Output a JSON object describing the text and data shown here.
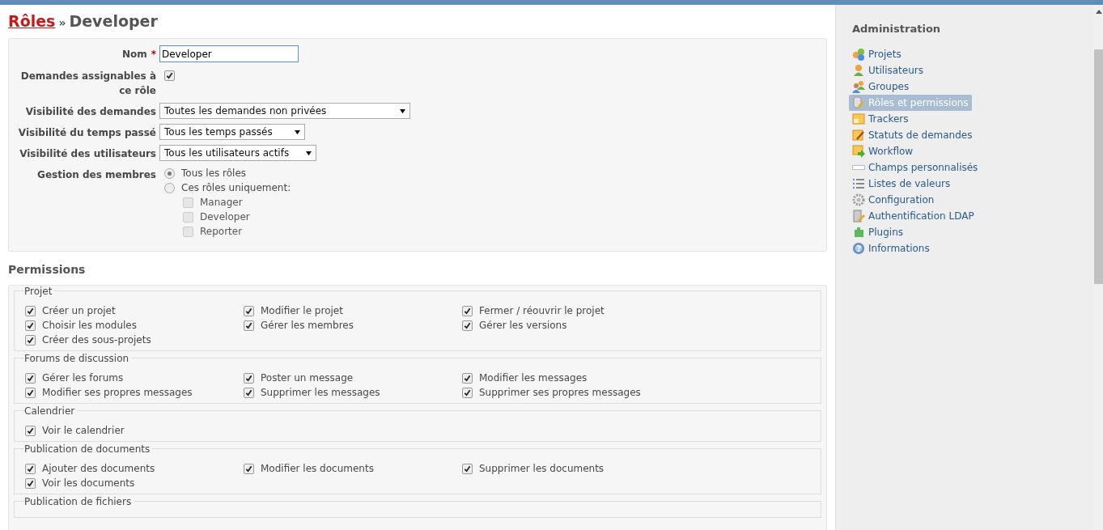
{
  "breadcrumb": {
    "link": "Rôles",
    "separator": "»",
    "current": "Developer"
  },
  "form": {
    "name": {
      "label": "Nom",
      "required_mark": "*",
      "value": "Developer"
    },
    "assignable": {
      "label": "Demandes assignables à ce rôle",
      "checked": true
    },
    "selects": [
      {
        "label": "Visibilité des demandes",
        "value": "Toutes les demandes non privées"
      },
      {
        "label": "Visibilité du temps passé",
        "value": "Tous les temps passés"
      },
      {
        "label": "Visibilité des utilisateurs",
        "value": "Tous les utilisateurs actifs"
      }
    ],
    "members": {
      "label": "Gestion des membres",
      "options": [
        {
          "label": "Tous les rôles",
          "selected": true
        },
        {
          "label": "Ces rôles uniquement:",
          "selected": false
        }
      ],
      "roles": [
        {
          "label": "Manager",
          "checked": false,
          "disabled": true
        },
        {
          "label": "Developer",
          "checked": false,
          "disabled": true
        },
        {
          "label": "Reporter",
          "checked": false,
          "disabled": true
        }
      ]
    }
  },
  "permissions": {
    "title": "Permissions",
    "groups": [
      {
        "legend": "Projet",
        "items": [
          {
            "label": "Créer un projet",
            "checked": true
          },
          {
            "label": "Modifier le projet",
            "checked": true
          },
          {
            "label": "Fermer / réouvrir le projet",
            "checked": true
          },
          {
            "label": "Choisir les modules",
            "checked": true
          },
          {
            "label": "Gérer les membres",
            "checked": true
          },
          {
            "label": "Gérer les versions",
            "checked": true
          },
          {
            "label": "Créer des sous-projets",
            "checked": true
          }
        ]
      },
      {
        "legend": "Forums de discussion",
        "items": [
          {
            "label": "Gérer les forums",
            "checked": true
          },
          {
            "label": "Poster un message",
            "checked": true
          },
          {
            "label": "Modifier les messages",
            "checked": true
          },
          {
            "label": "Modifier ses propres messages",
            "checked": true
          },
          {
            "label": "Supprimer les messages",
            "checked": true
          },
          {
            "label": "Supprimer ses propres messages",
            "checked": true
          }
        ]
      },
      {
        "legend": "Calendrier",
        "items": [
          {
            "label": "Voir le calendrier",
            "checked": true
          }
        ]
      },
      {
        "legend": "Publication de documents",
        "items": [
          {
            "label": "Ajouter des documents",
            "checked": true
          },
          {
            "label": "Modifier les documents",
            "checked": true
          },
          {
            "label": "Supprimer les documents",
            "checked": true
          },
          {
            "label": "Voir les documents",
            "checked": true
          }
        ]
      },
      {
        "legend": "Publication de fichiers"
      }
    ]
  },
  "sidebar": {
    "title": "Administration",
    "items": [
      {
        "label": "Projets",
        "selected": false
      },
      {
        "label": "Utilisateurs",
        "selected": false
      },
      {
        "label": "Groupes",
        "selected": false
      },
      {
        "label": "Rôles et permissions",
        "selected": true
      },
      {
        "label": "Trackers",
        "selected": false
      },
      {
        "label": "Statuts de demandes",
        "selected": false
      },
      {
        "label": "Workflow",
        "selected": false
      },
      {
        "label": "Champs personnalisés",
        "selected": false
      },
      {
        "label": "Listes de valeurs",
        "selected": false
      },
      {
        "label": "Configuration",
        "selected": false
      },
      {
        "label": "Authentification LDAP",
        "selected": false
      },
      {
        "label": "Plugins",
        "selected": false
      },
      {
        "label": "Informations",
        "selected": false
      }
    ]
  }
}
